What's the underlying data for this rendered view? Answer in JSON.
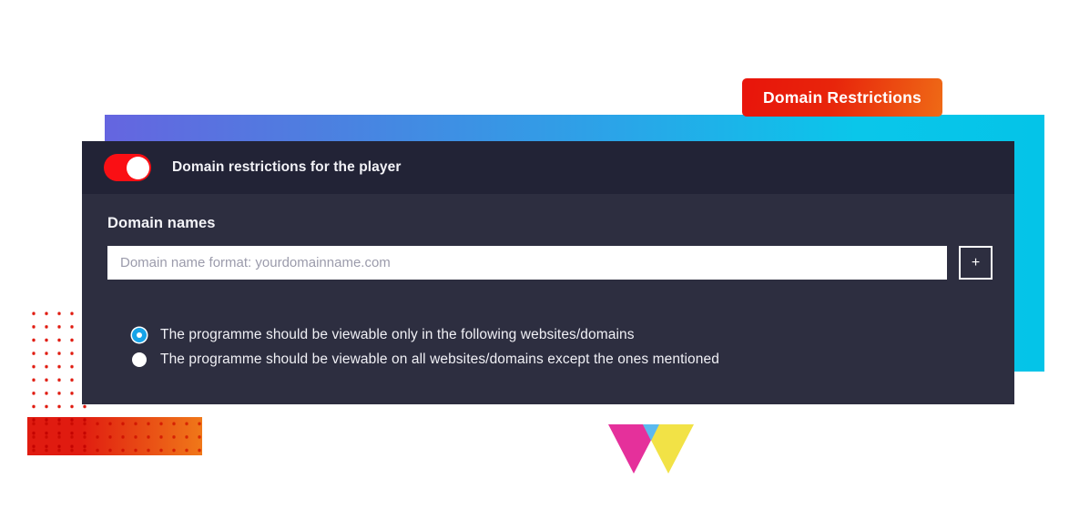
{
  "badge": {
    "label": "Domain Restrictions"
  },
  "panel": {
    "header": {
      "toggle_label": "Domain restrictions for the player",
      "toggle_state": "on",
      "toggle_color": "#fa0f14"
    },
    "body": {
      "domain_names_label": "Domain names",
      "domain_input": {
        "value": "",
        "placeholder": "Domain name format: yourdomainname.com"
      },
      "add_button_label": "+",
      "radio_options": [
        {
          "label": "The programme should be viewable only in the following websites/domains",
          "selected": true
        },
        {
          "label": "The programme should be viewable on all websites/domains except the ones mentioned",
          "selected": false
        }
      ]
    }
  },
  "decor": {
    "banner_gradient_from": "#6565e0",
    "banner_gradient_to": "#04c4e8",
    "panel_bg": "#2d2e40",
    "panel_header_bg": "#222336",
    "dots_color_start": "#e01b10",
    "dots_color_end": "#ef6a16",
    "logo_colors": [
      "#e5309b",
      "#5bb9ef",
      "#f2e246"
    ]
  }
}
